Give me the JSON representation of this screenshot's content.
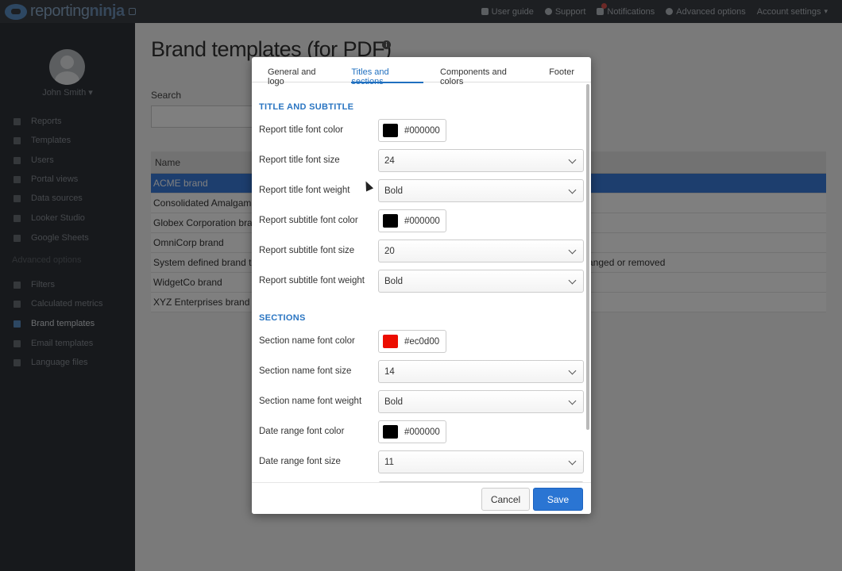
{
  "topbar": {
    "logo_text_light": "reporting",
    "logo_text_bold": "ninja",
    "nav": [
      {
        "label": "User guide",
        "icon": "book-icon"
      },
      {
        "label": "Support",
        "icon": "lifebuoy-icon"
      },
      {
        "label": "Notifications",
        "icon": "bell-icon"
      },
      {
        "label": "Advanced options",
        "icon": "settings-circle-icon"
      },
      {
        "label": "Account settings",
        "icon": "caret-down-icon"
      }
    ]
  },
  "sidebar": {
    "username": "John Smith",
    "items": [
      {
        "label": "Reports",
        "icon": "reports-icon"
      },
      {
        "label": "Templates",
        "icon": "templates-icon"
      },
      {
        "label": "Users",
        "icon": "user-icon"
      },
      {
        "label": "Portal views",
        "icon": "folder-icon"
      },
      {
        "label": "Data sources",
        "icon": "database-icon"
      },
      {
        "label": "Looker Studio",
        "icon": "looker-icon"
      },
      {
        "label": "Google Sheets",
        "icon": "sheets-icon"
      }
    ],
    "advanced_heading": "Advanced options",
    "advanced_items": [
      {
        "label": "Filters",
        "icon": "filter-icon"
      },
      {
        "label": "Calculated metrics",
        "icon": "plus-icon"
      },
      {
        "label": "Brand templates",
        "icon": "brand-icon",
        "active": true
      },
      {
        "label": "Email templates",
        "icon": "email-icon"
      },
      {
        "label": "Language files",
        "icon": "language-icon"
      }
    ]
  },
  "main": {
    "title": "Brand templates (for PDF)",
    "info": "i",
    "search_label": "Search",
    "table_header": "Name",
    "rows": [
      {
        "name": "ACME brand",
        "note": "",
        "selected": true
      },
      {
        "name": "Consolidated Amalgama",
        "note": ""
      },
      {
        "name": "Globex Corporation brar",
        "note": ""
      },
      {
        "name": "OmniCorp brand",
        "note": ""
      },
      {
        "name": "System defined brand te",
        "note": "anged or removed"
      },
      {
        "name": "WidgetCo brand",
        "note": ""
      },
      {
        "name": "XYZ Enterprises brand",
        "note": ""
      }
    ]
  },
  "modal": {
    "tabs": [
      {
        "label": "General and logo",
        "active": false
      },
      {
        "label": "Titles and sections",
        "active": true
      },
      {
        "label": "Components and colors",
        "active": false
      },
      {
        "label": "Footer",
        "active": false
      }
    ],
    "section_title": "TITLE AND SUBTITLE",
    "section_sections": "SECTIONS",
    "fields": {
      "report_title_color": {
        "label": "Report title font color",
        "value": "#000000",
        "swatch": "#000000"
      },
      "report_title_size": {
        "label": "Report title font size",
        "value": "24"
      },
      "report_title_weight": {
        "label": "Report title font weight",
        "value": "Bold"
      },
      "report_subtitle_color": {
        "label": "Report subtitle font color",
        "value": "#000000",
        "swatch": "#000000"
      },
      "report_subtitle_size": {
        "label": "Report subtitle font size",
        "value": "20"
      },
      "report_subtitle_weight": {
        "label": "Report subtitle font weight",
        "value": "Bold"
      },
      "section_name_color": {
        "label": "Section name font color",
        "value": "#ec0d00",
        "swatch": "#ec0d00"
      },
      "section_name_size": {
        "label": "Section name font size",
        "value": "14"
      },
      "section_name_weight": {
        "label": "Section name font weight",
        "value": "Bold"
      },
      "date_range_color": {
        "label": "Date range font color",
        "value": "#000000",
        "swatch": "#000000"
      },
      "date_range_size": {
        "label": "Date range font size",
        "value": "11"
      }
    },
    "cancel_label": "Cancel",
    "save_label": "Save"
  },
  "colors": {
    "accent": "#2a75d3",
    "selected_row": "#3b7ddd",
    "section_heading": "#2a75c2"
  }
}
